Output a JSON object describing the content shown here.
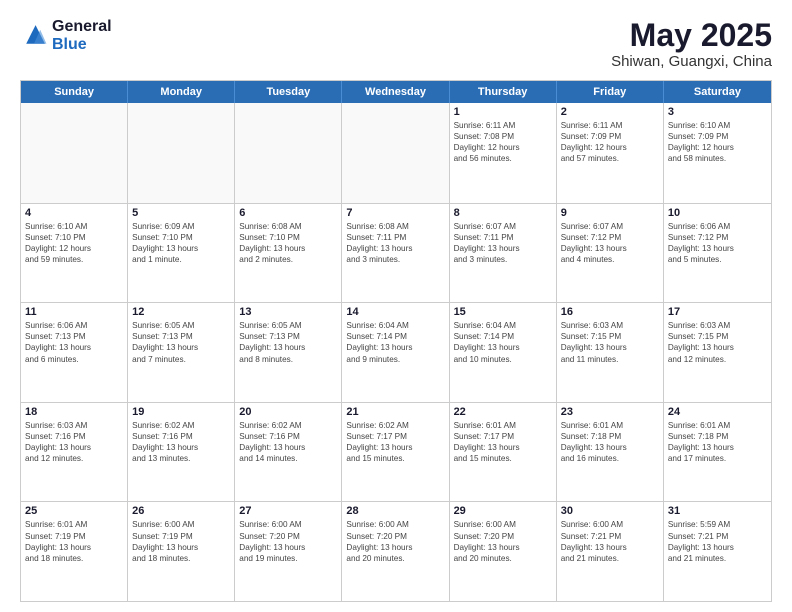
{
  "logo": {
    "general": "General",
    "blue": "Blue"
  },
  "title": {
    "month_year": "May 2025",
    "location": "Shiwan, Guangxi, China"
  },
  "header_days": [
    "Sunday",
    "Monday",
    "Tuesday",
    "Wednesday",
    "Thursday",
    "Friday",
    "Saturday"
  ],
  "weeks": [
    [
      {
        "day": "",
        "detail": ""
      },
      {
        "day": "",
        "detail": ""
      },
      {
        "day": "",
        "detail": ""
      },
      {
        "day": "",
        "detail": ""
      },
      {
        "day": "1",
        "detail": "Sunrise: 6:11 AM\nSunset: 7:08 PM\nDaylight: 12 hours\nand 56 minutes."
      },
      {
        "day": "2",
        "detail": "Sunrise: 6:11 AM\nSunset: 7:09 PM\nDaylight: 12 hours\nand 57 minutes."
      },
      {
        "day": "3",
        "detail": "Sunrise: 6:10 AM\nSunset: 7:09 PM\nDaylight: 12 hours\nand 58 minutes."
      }
    ],
    [
      {
        "day": "4",
        "detail": "Sunrise: 6:10 AM\nSunset: 7:10 PM\nDaylight: 12 hours\nand 59 minutes."
      },
      {
        "day": "5",
        "detail": "Sunrise: 6:09 AM\nSunset: 7:10 PM\nDaylight: 13 hours\nand 1 minute."
      },
      {
        "day": "6",
        "detail": "Sunrise: 6:08 AM\nSunset: 7:10 PM\nDaylight: 13 hours\nand 2 minutes."
      },
      {
        "day": "7",
        "detail": "Sunrise: 6:08 AM\nSunset: 7:11 PM\nDaylight: 13 hours\nand 3 minutes."
      },
      {
        "day": "8",
        "detail": "Sunrise: 6:07 AM\nSunset: 7:11 PM\nDaylight: 13 hours\nand 3 minutes."
      },
      {
        "day": "9",
        "detail": "Sunrise: 6:07 AM\nSunset: 7:12 PM\nDaylight: 13 hours\nand 4 minutes."
      },
      {
        "day": "10",
        "detail": "Sunrise: 6:06 AM\nSunset: 7:12 PM\nDaylight: 13 hours\nand 5 minutes."
      }
    ],
    [
      {
        "day": "11",
        "detail": "Sunrise: 6:06 AM\nSunset: 7:13 PM\nDaylight: 13 hours\nand 6 minutes."
      },
      {
        "day": "12",
        "detail": "Sunrise: 6:05 AM\nSunset: 7:13 PM\nDaylight: 13 hours\nand 7 minutes."
      },
      {
        "day": "13",
        "detail": "Sunrise: 6:05 AM\nSunset: 7:13 PM\nDaylight: 13 hours\nand 8 minutes."
      },
      {
        "day": "14",
        "detail": "Sunrise: 6:04 AM\nSunset: 7:14 PM\nDaylight: 13 hours\nand 9 minutes."
      },
      {
        "day": "15",
        "detail": "Sunrise: 6:04 AM\nSunset: 7:14 PM\nDaylight: 13 hours\nand 10 minutes."
      },
      {
        "day": "16",
        "detail": "Sunrise: 6:03 AM\nSunset: 7:15 PM\nDaylight: 13 hours\nand 11 minutes."
      },
      {
        "day": "17",
        "detail": "Sunrise: 6:03 AM\nSunset: 7:15 PM\nDaylight: 13 hours\nand 12 minutes."
      }
    ],
    [
      {
        "day": "18",
        "detail": "Sunrise: 6:03 AM\nSunset: 7:16 PM\nDaylight: 13 hours\nand 12 minutes."
      },
      {
        "day": "19",
        "detail": "Sunrise: 6:02 AM\nSunset: 7:16 PM\nDaylight: 13 hours\nand 13 minutes."
      },
      {
        "day": "20",
        "detail": "Sunrise: 6:02 AM\nSunset: 7:16 PM\nDaylight: 13 hours\nand 14 minutes."
      },
      {
        "day": "21",
        "detail": "Sunrise: 6:02 AM\nSunset: 7:17 PM\nDaylight: 13 hours\nand 15 minutes."
      },
      {
        "day": "22",
        "detail": "Sunrise: 6:01 AM\nSunset: 7:17 PM\nDaylight: 13 hours\nand 15 minutes."
      },
      {
        "day": "23",
        "detail": "Sunrise: 6:01 AM\nSunset: 7:18 PM\nDaylight: 13 hours\nand 16 minutes."
      },
      {
        "day": "24",
        "detail": "Sunrise: 6:01 AM\nSunset: 7:18 PM\nDaylight: 13 hours\nand 17 minutes."
      }
    ],
    [
      {
        "day": "25",
        "detail": "Sunrise: 6:01 AM\nSunset: 7:19 PM\nDaylight: 13 hours\nand 18 minutes."
      },
      {
        "day": "26",
        "detail": "Sunrise: 6:00 AM\nSunset: 7:19 PM\nDaylight: 13 hours\nand 18 minutes."
      },
      {
        "day": "27",
        "detail": "Sunrise: 6:00 AM\nSunset: 7:20 PM\nDaylight: 13 hours\nand 19 minutes."
      },
      {
        "day": "28",
        "detail": "Sunrise: 6:00 AM\nSunset: 7:20 PM\nDaylight: 13 hours\nand 20 minutes."
      },
      {
        "day": "29",
        "detail": "Sunrise: 6:00 AM\nSunset: 7:20 PM\nDaylight: 13 hours\nand 20 minutes."
      },
      {
        "day": "30",
        "detail": "Sunrise: 6:00 AM\nSunset: 7:21 PM\nDaylight: 13 hours\nand 21 minutes."
      },
      {
        "day": "31",
        "detail": "Sunrise: 5:59 AM\nSunset: 7:21 PM\nDaylight: 13 hours\nand 21 minutes."
      }
    ]
  ]
}
